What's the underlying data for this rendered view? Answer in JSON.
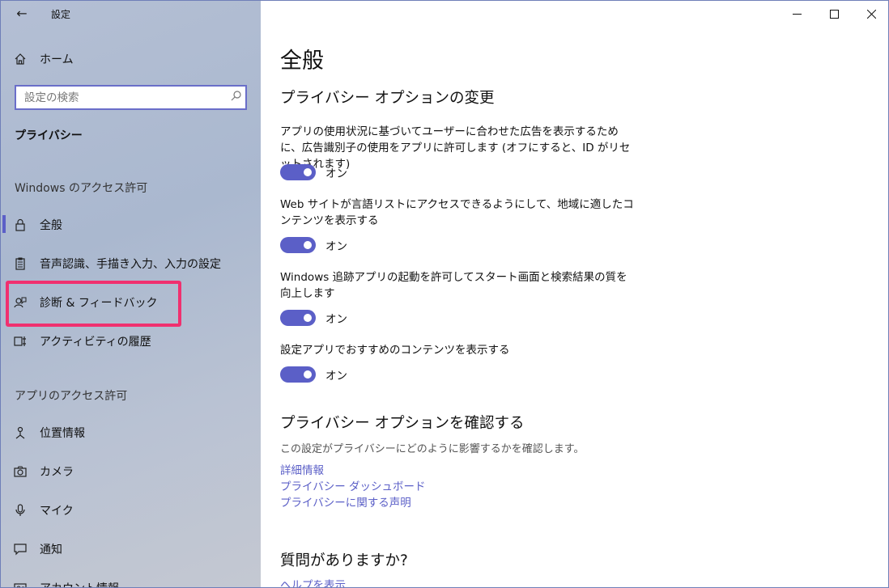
{
  "window": {
    "title": "設定"
  },
  "sidebar": {
    "home_label": "ホーム",
    "search_placeholder": "設定の検索",
    "section_title": "プライバシー",
    "group_windows": "Windows のアクセス許可",
    "items_windows": [
      {
        "label": "全般",
        "icon": "lock-icon"
      },
      {
        "label": "音声認識、手描き入力、入力の設定",
        "icon": "clipboard-icon"
      },
      {
        "label": "診断 & フィードバック",
        "icon": "feedback-person-icon"
      },
      {
        "label": "アクティビティの履歴",
        "icon": "timeline-icon"
      }
    ],
    "group_apps": "アプリのアクセス許可",
    "items_apps": [
      {
        "label": "位置情報",
        "icon": "location-person-icon"
      },
      {
        "label": "カメラ",
        "icon": "camera-icon"
      },
      {
        "label": "マイク",
        "icon": "microphone-icon"
      },
      {
        "label": "通知",
        "icon": "notification-icon"
      },
      {
        "label": "アカウント情報",
        "icon": "account-icon"
      }
    ]
  },
  "main": {
    "page_title": "全般",
    "options_heading": "プライバシー オプションの変更",
    "options": [
      {
        "text": "アプリの使用状況に基づいてユーザーに合わせた広告を表示するために、広告識別子の使用をアプリに許可します (オフにすると、ID がリセットされます)",
        "state": "オン"
      },
      {
        "text": "Web サイトが言語リストにアクセスできるようにして、地域に適したコンテンツを表示する",
        "state": "オン"
      },
      {
        "text": "Windows 追跡アプリの起動を許可してスタート画面と検索結果の質を向上します",
        "state": "オン"
      },
      {
        "text": "設定アプリでおすすめのコンテンツを表示する",
        "state": "オン"
      }
    ],
    "review_heading": "プライバシー オプションを確認する",
    "review_text": "この設定がプライバシーにどのように影響するかを確認します。",
    "links": [
      "詳細情報",
      "プライバシー ダッシュボード",
      "プライバシーに関する声明"
    ],
    "question_heading": "質問がありますか?",
    "help_link": "ヘルプを表示"
  },
  "colors": {
    "accent": "#5b5fc7",
    "highlight": "#f0306f"
  }
}
